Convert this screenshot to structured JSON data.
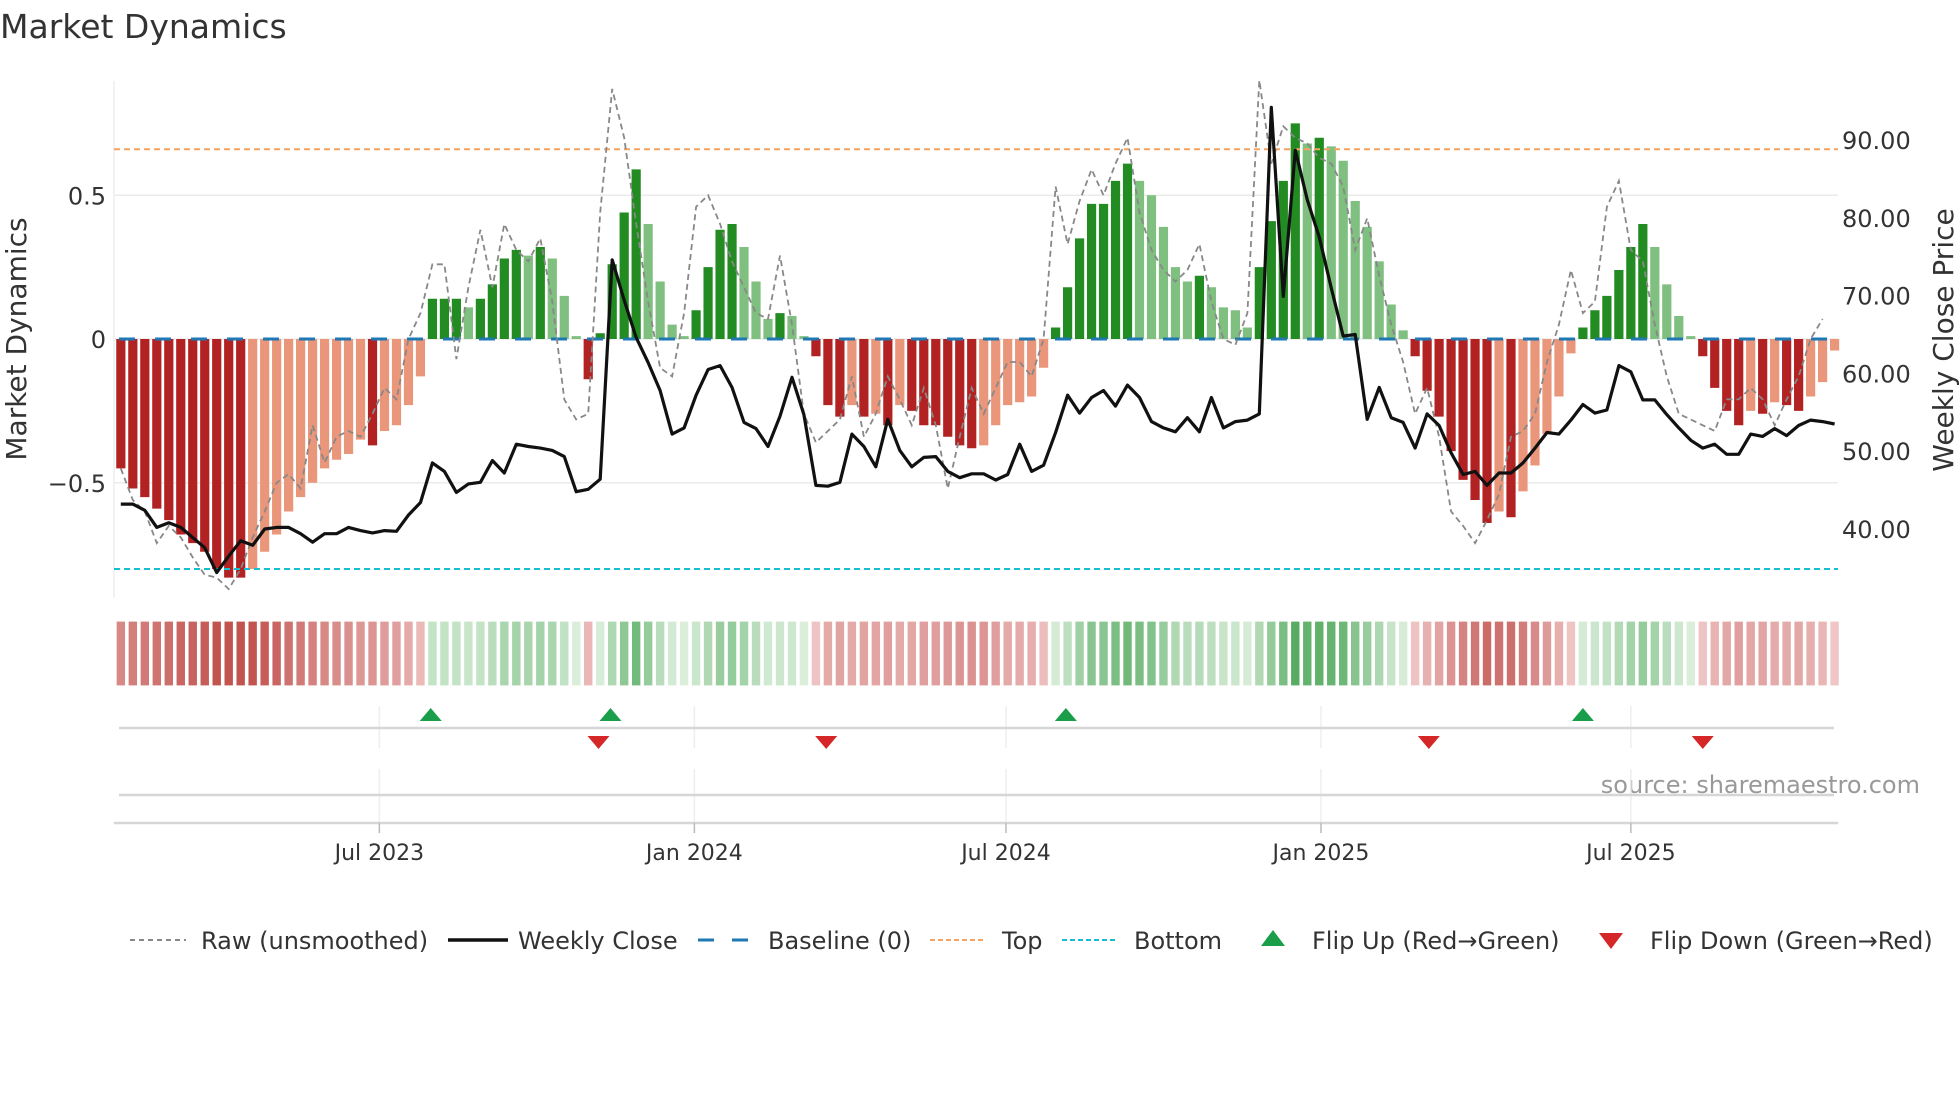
{
  "chart_data": {
    "type": "bar",
    "title": "Market Dynamics",
    "ylabel_left": "Market Dynamics",
    "ylabel_right": "Weekly Close Price",
    "source": "source: sharemaestro.com",
    "x_range": [
      "2023-01-27",
      "2025-10-30"
    ],
    "bar_start_week": "2023-01-31",
    "ylim_left": [
      -0.9,
      0.93
    ],
    "ylim_right": [
      30,
      100
    ],
    "left_ticks": [
      {
        "value": 0.5,
        "label": "0.5"
      },
      {
        "value": 0,
        "label": "0"
      },
      {
        "value": -0.5,
        "label": "−0.5"
      }
    ],
    "right_ticks": [
      {
        "value": 90,
        "label": "90.00"
      },
      {
        "value": 80,
        "label": "80.00"
      },
      {
        "value": 70,
        "label": "70.00"
      },
      {
        "value": 60,
        "label": "60.00"
      },
      {
        "value": 50,
        "label": "50.00"
      },
      {
        "value": 40,
        "label": "40.00"
      }
    ],
    "x_ticks": [
      {
        "date": "2023-07-01",
        "label": "Jul 2023"
      },
      {
        "date": "2024-01-01",
        "label": "Jan 2024"
      },
      {
        "date": "2024-07-01",
        "label": "Jul 2024"
      },
      {
        "date": "2025-01-01",
        "label": "Jan 2025"
      },
      {
        "date": "2025-07-01",
        "label": "Jul 2025"
      }
    ],
    "top_level": 0.66,
    "bottom_level": -0.8,
    "baseline": 0,
    "momentum": [
      -0.45,
      -0.52,
      -0.55,
      -0.59,
      -0.63,
      -0.68,
      -0.71,
      -0.74,
      -0.8,
      -0.83,
      -0.83,
      -0.8,
      -0.74,
      -0.68,
      -0.6,
      -0.55,
      -0.5,
      -0.45,
      -0.42,
      -0.4,
      -0.35,
      -0.37,
      -0.32,
      -0.3,
      -0.23,
      -0.13,
      0.14,
      0.14,
      0.14,
      0.11,
      0.14,
      0.19,
      0.28,
      0.31,
      0.29,
      0.32,
      0.28,
      0.15,
      0.01,
      -0.14,
      0.02,
      0.26,
      0.44,
      0.59,
      0.4,
      0.2,
      0.05,
      0.01,
      0.1,
      0.25,
      0.38,
      0.4,
      0.32,
      0.2,
      0.07,
      0.09,
      0.08,
      0.01,
      -0.06,
      -0.23,
      -0.27,
      -0.23,
      -0.27,
      -0.26,
      -0.3,
      -0.23,
      -0.25,
      -0.3,
      -0.3,
      -0.34,
      -0.37,
      -0.38,
      -0.37,
      -0.3,
      -0.23,
      -0.22,
      -0.2,
      -0.1,
      0.04,
      0.18,
      0.35,
      0.47,
      0.47,
      0.55,
      0.61,
      0.55,
      0.5,
      0.39,
      0.25,
      0.2,
      0.22,
      0.18,
      0.11,
      0.1,
      0.04,
      0.25,
      0.41,
      0.55,
      0.75,
      0.68,
      0.7,
      0.67,
      0.62,
      0.48,
      0.39,
      0.27,
      0.12,
      0.03,
      -0.06,
      -0.18,
      -0.27,
      -0.39,
      -0.49,
      -0.56,
      -0.64,
      -0.6,
      -0.62,
      -0.53,
      -0.44,
      -0.33,
      -0.2,
      -0.05,
      0.04,
      0.1,
      0.15,
      0.24,
      0.32,
      0.4,
      0.32,
      0.19,
      0.08,
      0.01,
      -0.06,
      -0.17,
      -0.25,
      -0.3,
      -0.25,
      -0.26,
      -0.22,
      -0.23,
      -0.25,
      -0.2,
      -0.15,
      -0.04
    ],
    "raw": [
      -0.45,
      -0.56,
      -0.6,
      -0.71,
      -0.65,
      -0.69,
      -0.76,
      -0.82,
      -0.83,
      -0.87,
      -0.8,
      -0.69,
      -0.6,
      -0.5,
      -0.47,
      -0.52,
      -0.3,
      -0.43,
      -0.34,
      -0.32,
      -0.34,
      -0.26,
      -0.17,
      -0.21,
      0,
      0.09,
      0.26,
      0.26,
      -0.07,
      0.18,
      0.38,
      0.18,
      0.4,
      0.31,
      0.27,
      0.35,
      0.13,
      -0.21,
      -0.28,
      -0.26,
      0.44,
      0.87,
      0.7,
      0.4,
      0.13,
      -0.1,
      -0.13,
      0.09,
      0.46,
      0.5,
      0.4,
      0.27,
      0.18,
      0.09,
      0.07,
      0.29,
      0.05,
      -0.26,
      -0.36,
      -0.32,
      -0.28,
      -0.13,
      -0.34,
      -0.26,
      -0.13,
      -0.21,
      -0.3,
      -0.17,
      -0.3,
      -0.52,
      -0.34,
      -0.17,
      -0.26,
      -0.17,
      -0.08,
      -0.08,
      -0.13,
      0,
      0.53,
      0.33,
      0.48,
      0.59,
      0.5,
      0.61,
      0.7,
      0.44,
      0.31,
      0.24,
      0.2,
      0.24,
      0.33,
      0.13,
      0,
      -0.02,
      0.09,
      0.9,
      0.61,
      0.74,
      0.7,
      0.68,
      0.63,
      0.61,
      0.53,
      0.31,
      0.42,
      0.22,
      0.05,
      -0.08,
      -0.26,
      -0.17,
      -0.34,
      -0.6,
      -0.65,
      -0.71,
      -0.63,
      -0.54,
      -0.34,
      -0.32,
      -0.26,
      -0.08,
      0.05,
      0.24,
      0.09,
      0.13,
      0.46,
      0.55,
      0.31,
      0.27,
      0.05,
      -0.13,
      -0.26,
      -0.28,
      -0.3,
      -0.32,
      -0.21,
      -0.21,
      -0.17,
      -0.21,
      -0.3,
      -0.21,
      -0.13,
      0,
      0.07
    ],
    "weekly_close": [
      43.2,
      43.2,
      42.4,
      40.2,
      40.8,
      40.2,
      38.9,
      37.6,
      34.4,
      36.5,
      38.5,
      37.9,
      40,
      40.2,
      40.2,
      39.4,
      38.3,
      39.4,
      39.4,
      40.2,
      39.8,
      39.5,
      39.8,
      39.7,
      41.8,
      43.4,
      48.5,
      47.4,
      44.7,
      45.8,
      46,
      48.8,
      47.2,
      50.9,
      50.6,
      50.4,
      50.1,
      49.3,
      44.8,
      45.1,
      46.4,
      74.6,
      69.4,
      64.6,
      61.4,
      57.8,
      52.2,
      53,
      57.2,
      60.5,
      61,
      58.2,
      53.7,
      52.9,
      50.6,
      54.5,
      59.5,
      54.7,
      45.6,
      45.5,
      46,
      52.2,
      50.6,
      48,
      54.1,
      50.1,
      48,
      49.2,
      49.3,
      47.4,
      46.6,
      47.1,
      47.1,
      46.3,
      47,
      50.9,
      47.4,
      48.2,
      52.4,
      57.2,
      54.9,
      56.9,
      57.8,
      55.8,
      58.5,
      56.9,
      53.8,
      53,
      52.5,
      54.3,
      52.5,
      56.9,
      53,
      53.8,
      54,
      54.8,
      94.2,
      69.9,
      88.7,
      82.3,
      77.5,
      71,
      64.8,
      65,
      54.1,
      58.2,
      54.3,
      53.7,
      50.4,
      54.8,
      53.3,
      49.8,
      47,
      47.4,
      45.6,
      47.2,
      47.2,
      48.5,
      50.4,
      52.4,
      52.2,
      54,
      56,
      54.9,
      55.3,
      61,
      60.2,
      56.6,
      56.6,
      54.7,
      53,
      51.4,
      50.4,
      50.9,
      49.6,
      49.6,
      52.2,
      51.9,
      52.9,
      52,
      53.3,
      54,
      53.8,
      53.5
    ],
    "flip_up_dates": [
      "2023-07-31",
      "2023-11-13",
      "2024-08-05",
      "2025-06-03"
    ],
    "flip_down_dates": [
      "2023-11-06",
      "2024-03-18",
      "2025-03-05",
      "2025-08-12"
    ],
    "legend": [
      {
        "key": "raw",
        "label": "Raw (unsmoothed)"
      },
      {
        "key": "close",
        "label": "Weekly Close"
      },
      {
        "key": "baseline",
        "label": "Baseline (0)"
      },
      {
        "key": "top",
        "label": "Top"
      },
      {
        "key": "bottom",
        "label": "Bottom"
      },
      {
        "key": "flipup",
        "label": "Flip Up (Red→Green)"
      },
      {
        "key": "flipdown",
        "label": "Flip Down (Green→Red)"
      }
    ],
    "legend_placement": "bottom",
    "colors": {
      "green_strong": "#228b22",
      "green_light": "#7fbf7f",
      "red_strong": "#b22222",
      "red_light": "#e9967a",
      "raw": "#888888",
      "close": "#111111",
      "baseline": "#1f77b4",
      "top": "#f4a460",
      "bottom": "#17becf",
      "flip_up": "#1a9e4a",
      "flip_down": "#d62728"
    }
  }
}
